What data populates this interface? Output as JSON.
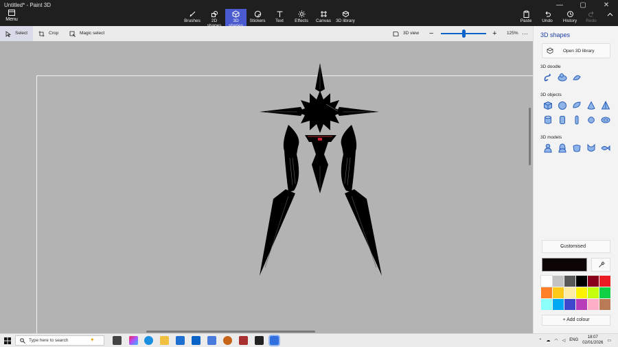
{
  "window": {
    "title": "Untitled* - Paint 3D",
    "menu_label": "Menu",
    "controls": [
      "—",
      "▢",
      "✕"
    ]
  },
  "ribbon": {
    "tools": [
      {
        "label": "Brushes",
        "icon": "brush-icon"
      },
      {
        "label": "2D shapes",
        "icon": "2d-shapes-icon"
      },
      {
        "label": "3D shapes",
        "icon": "3d-shapes-icon",
        "active": true
      },
      {
        "label": "Stickers",
        "icon": "stickers-icon"
      },
      {
        "label": "Text",
        "icon": "text-icon"
      },
      {
        "label": "Effects",
        "icon": "effects-icon"
      },
      {
        "label": "Canvas",
        "icon": "canvas-icon"
      },
      {
        "label": "3D library",
        "icon": "3d-library-icon"
      }
    ],
    "right": {
      "paste": "Paste",
      "undo": "Undo",
      "history": "History",
      "redo": "Redo"
    }
  },
  "toolbar": {
    "select": "Select",
    "crop": "Crop",
    "magic_select": "Magic select",
    "view_3d": "3D view",
    "zoom": "125%",
    "zoom_fraction": 0.5
  },
  "panel": {
    "title": "3D shapes",
    "open_library": "Open 3D library",
    "doodle_label": "3D doodle",
    "objects_label": "3D objects",
    "models_label": "3D models",
    "dropdown": "Customised",
    "current_color": "#0d0505",
    "add_colour": "Add colour",
    "palette": [
      "#ffffff",
      "#c3c3c3",
      "#585858",
      "#000000",
      "#88001b",
      "#ec1c24",
      "#ff7f27",
      "#ffca18",
      "#fdeca6",
      "#fff200",
      "#c4ff0e",
      "#0ed145",
      "#8cfffb",
      "#00a8f3",
      "#3f48cc",
      "#b83dba",
      "#ffaec8",
      "#b97a56"
    ]
  },
  "taskbar": {
    "search_placeholder": "Type here to search",
    "language": "ENG",
    "time": "18:07",
    "date": "02/01/2026"
  }
}
